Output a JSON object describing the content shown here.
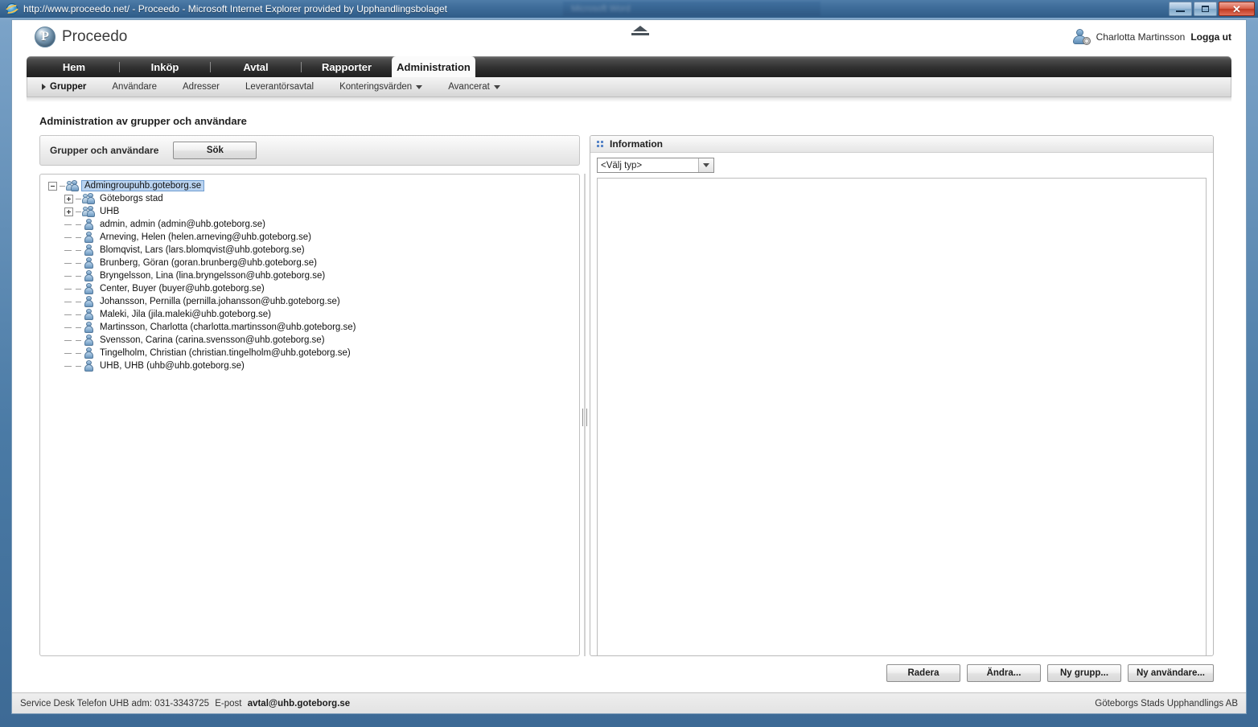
{
  "window": {
    "title": "http://www.proceedo.net/ - Proceedo - Microsoft Internet Explorer provided by Upphandlingsbolaget",
    "background_window_title": "Microsoft Word",
    "minimize_label": "Minimera",
    "restore_label": "Återställ",
    "close_label": "✕"
  },
  "header": {
    "brand": "Proceedo",
    "user_name": "Charlotta Martinsson",
    "logout": "Logga ut"
  },
  "nav": {
    "tabs": [
      {
        "label": "Hem",
        "active": false
      },
      {
        "label": "Inköp",
        "active": false
      },
      {
        "label": "Avtal",
        "active": false
      },
      {
        "label": "Rapporter",
        "active": false
      },
      {
        "label": "Administration",
        "active": true
      }
    ]
  },
  "subnav": {
    "items": [
      {
        "label": "Grupper",
        "active": true,
        "caret": "right"
      },
      {
        "label": "Användare",
        "active": false,
        "caret": "none"
      },
      {
        "label": "Adresser",
        "active": false,
        "caret": "none"
      },
      {
        "label": "Leverantörsavtal",
        "active": false,
        "caret": "none"
      },
      {
        "label": "Konteringsvärden",
        "active": false,
        "caret": "down"
      },
      {
        "label": "Avancerat",
        "active": false,
        "caret": "down"
      }
    ]
  },
  "page": {
    "title": "Administration av grupper och användare"
  },
  "search": {
    "label": "Grupper och användare",
    "button": "Sök"
  },
  "tree": {
    "nodes": [
      {
        "label": "Admingroupuhb.goteborg.se",
        "type": "group",
        "level": 1,
        "expander": "minus",
        "selected": true
      },
      {
        "label": "Göteborgs stad",
        "type": "group",
        "level": 2,
        "expander": "plus",
        "selected": false
      },
      {
        "label": "UHB",
        "type": "group",
        "level": 2,
        "expander": "plus",
        "selected": false
      },
      {
        "label": "admin, admin (admin@uhb.goteborg.se)",
        "type": "user",
        "level": 2,
        "expander": "none",
        "selected": false
      },
      {
        "label": "Arneving, Helen (helen.arneving@uhb.goteborg.se)",
        "type": "user",
        "level": 2,
        "expander": "none",
        "selected": false
      },
      {
        "label": "Blomqvist, Lars (lars.blomqvist@uhb.goteborg.se)",
        "type": "user",
        "level": 2,
        "expander": "none",
        "selected": false
      },
      {
        "label": "Brunberg, Göran (goran.brunberg@uhb.goteborg.se)",
        "type": "user",
        "level": 2,
        "expander": "none",
        "selected": false
      },
      {
        "label": "Bryngelsson, Lina (lina.bryngelsson@uhb.goteborg.se)",
        "type": "user",
        "level": 2,
        "expander": "none",
        "selected": false
      },
      {
        "label": "Center, Buyer (buyer@uhb.goteborg.se)",
        "type": "user",
        "level": 2,
        "expander": "none",
        "selected": false
      },
      {
        "label": "Johansson, Pernilla (pernilla.johansson@uhb.goteborg.se)",
        "type": "user",
        "level": 2,
        "expander": "none",
        "selected": false
      },
      {
        "label": "Maleki, Jila (jila.maleki@uhb.goteborg.se)",
        "type": "user",
        "level": 2,
        "expander": "none",
        "selected": false
      },
      {
        "label": "Martinsson, Charlotta (charlotta.martinsson@uhb.goteborg.se)",
        "type": "user",
        "level": 2,
        "expander": "none",
        "selected": false
      },
      {
        "label": "Svensson, Carina (carina.svensson@uhb.goteborg.se)",
        "type": "user",
        "level": 2,
        "expander": "none",
        "selected": false
      },
      {
        "label": "Tingelholm, Christian (christian.tingelholm@uhb.goteborg.se)",
        "type": "user",
        "level": 2,
        "expander": "none",
        "selected": false
      },
      {
        "label": "UHB, UHB (uhb@uhb.goteborg.se)",
        "type": "user",
        "level": 2,
        "expander": "none",
        "selected": false
      }
    ]
  },
  "info": {
    "title": "Information",
    "type_select_value": "<Välj typ>"
  },
  "actions": {
    "delete": "Radera",
    "edit": "Ändra...",
    "new_group": "Ny grupp...",
    "new_user": "Ny användare..."
  },
  "footer": {
    "service_desk": "Service Desk Telefon UHB adm: 031-3343725",
    "email_label": "E-post",
    "email": "avtal@uhb.goteborg.se",
    "company": "Göteborgs Stads Upphandlings AB"
  },
  "colors": {
    "accent": "#5a87c8",
    "selection": "#b9d3f0",
    "nav_dark": "#1f1f1f",
    "close_red": "#bf3a22"
  }
}
